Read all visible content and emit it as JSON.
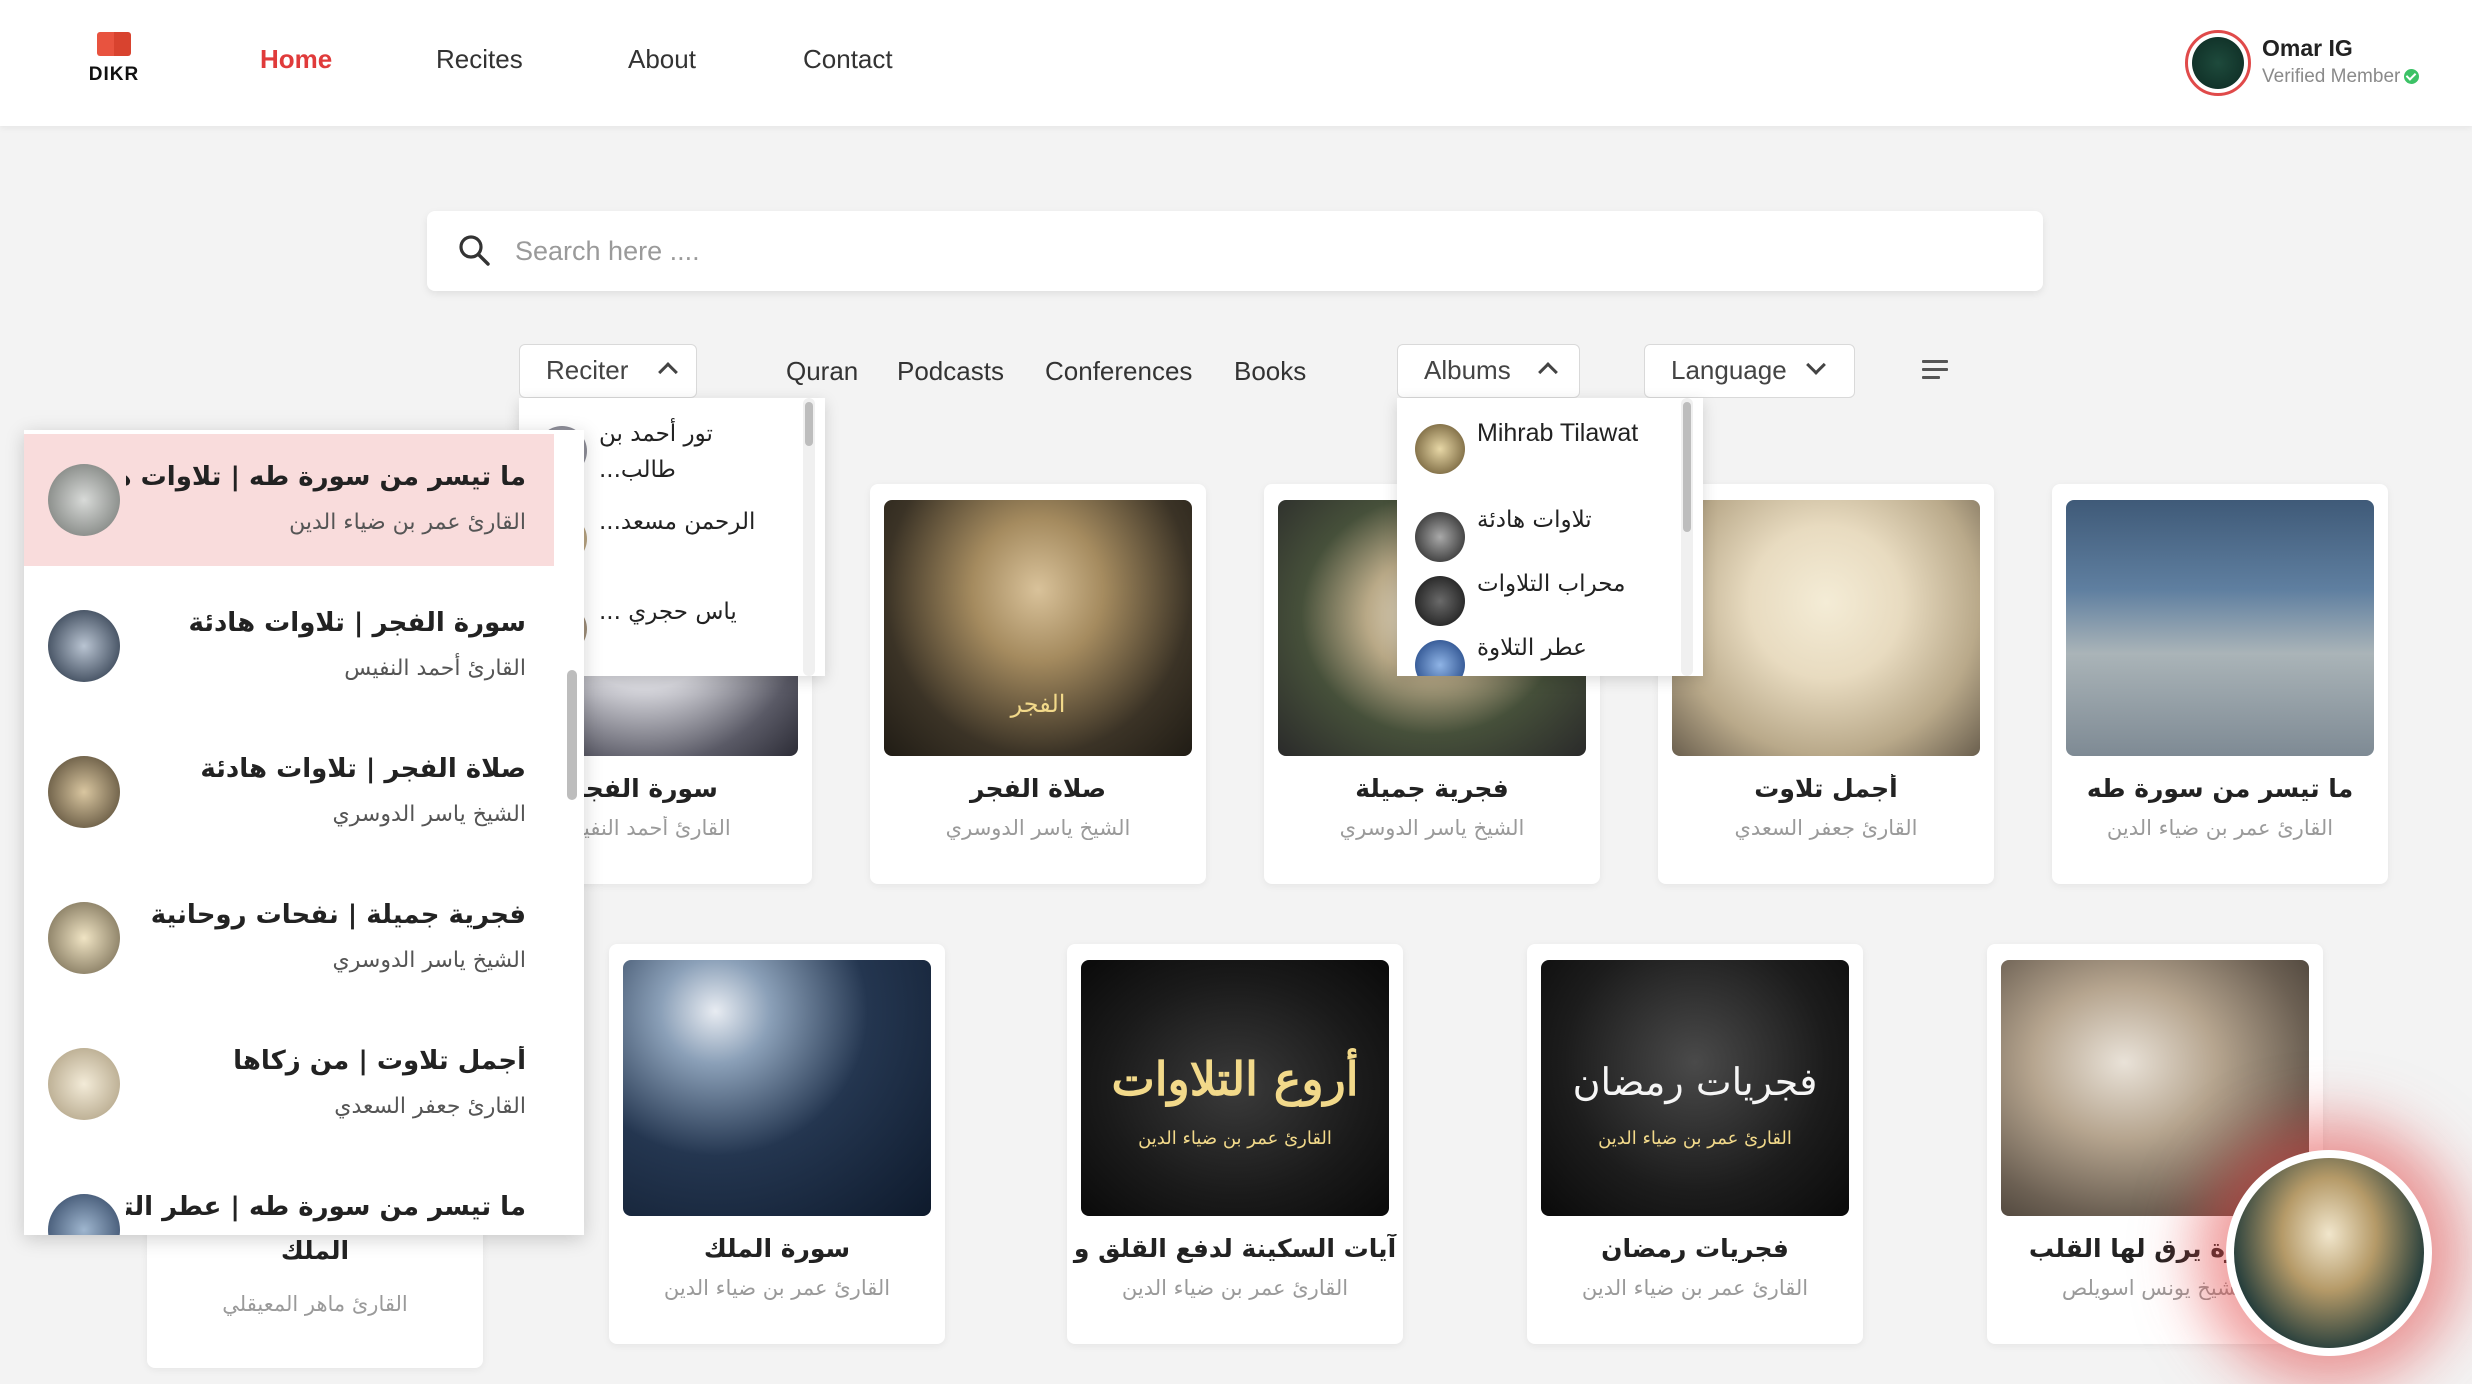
{
  "app": {
    "logo_text": "DIKR",
    "colors": {
      "accent": "#e03b3b",
      "highlight": "#f9dcdc",
      "verified": "#3cc266"
    }
  },
  "nav": {
    "links": [
      {
        "label": "Home",
        "active": true
      },
      {
        "label": "Recites",
        "active": false
      },
      {
        "label": "About",
        "active": false
      },
      {
        "label": "Contact",
        "active": false
      }
    ]
  },
  "user": {
    "name": "Omar IG",
    "status": "Verified Member"
  },
  "search": {
    "placeholder": "Search here ....",
    "value": ""
  },
  "filters": {
    "reciter": {
      "label": "Reciter",
      "open": true
    },
    "categories": [
      "Quran",
      "Podcasts",
      "Conferences",
      "Books"
    ],
    "albums": {
      "label": "Albums",
      "open": true
    },
    "language": {
      "label": "Language",
      "open": false
    },
    "sort_icon": "sort-lines-icon"
  },
  "reciter_dropdown": {
    "items": [
      "تور أحمد بن طالب...",
      "الرحمن مسعد...",
      "ياس حجري ..."
    ]
  },
  "albums_dropdown": {
    "items": [
      "Mihrab Tilawat",
      "تلاوات هادئة",
      "محراب التلاوات",
      "عطر التلاوة"
    ]
  },
  "list_panel": {
    "items": [
      {
        "title": "ما تيسر من سورة طه | تلاوات هادئة",
        "reciter": "القارئ عمر بن ضياء الدين",
        "highlighted": true
      },
      {
        "title": "سورة الفجر | تلاوات هادئة",
        "reciter": "القارئ أحمد النفيس",
        "highlighted": false
      },
      {
        "title": "صلاة الفجر | تلاوات هادئة",
        "reciter": "الشيخ ياسر الدوسري",
        "highlighted": false
      },
      {
        "title": "فجرية جميلة | نفحات روحانية",
        "reciter": "الشيخ ياسر الدوسري",
        "highlighted": false
      },
      {
        "title": "أجمل تلاوت | من زكاها",
        "reciter": "القارئ جعفر السعدي",
        "highlighted": false
      },
      {
        "title": "ما تيسر من سورة طه | عطر التلاوة",
        "reciter": "",
        "highlighted": false
      }
    ]
  },
  "cards_row1": [
    {
      "title": "سورة الفجر",
      "reciter": "القارئ أحمد النفيس"
    },
    {
      "title": "صلاة الفجر",
      "reciter": "الشيخ ياسر الدوسري",
      "caption": "الفجر"
    },
    {
      "title": "فجرية جميلة",
      "reciter": "الشيخ ياسر الدوسري"
    },
    {
      "title": "أجمل تلاوت",
      "reciter": "القارئ جعفر السعدي"
    },
    {
      "title": "ما تيسر من سورة طه",
      "reciter": "القارئ عمر بن ضياء الدين"
    }
  ],
  "cards_row2": [
    {
      "title": "الملك",
      "reciter": "القارئ ماهر المعيقلي"
    },
    {
      "title": "سورة الملك",
      "reciter": "القارئ عمر بن ضياء الدين"
    },
    {
      "title": "آيات السكينة لدفع القلق و",
      "reciter": "القارئ عمر بن ضياء الدين",
      "caption": "أروع التلاوات",
      "caption_sub": "القارئ عمر بن ضياء الدين"
    },
    {
      "title": "فجريات رمضان",
      "reciter": "القارئ عمر بن ضياء الدين",
      "caption": "فجريات رمضان",
      "caption_sub": "القارئ عمر بن ضياء الدين"
    },
    {
      "title": "مؤثرة يرق لها القلب",
      "reciter": "الشيخ يونس اسويلص"
    }
  ],
  "player": {
    "state": "playing"
  }
}
